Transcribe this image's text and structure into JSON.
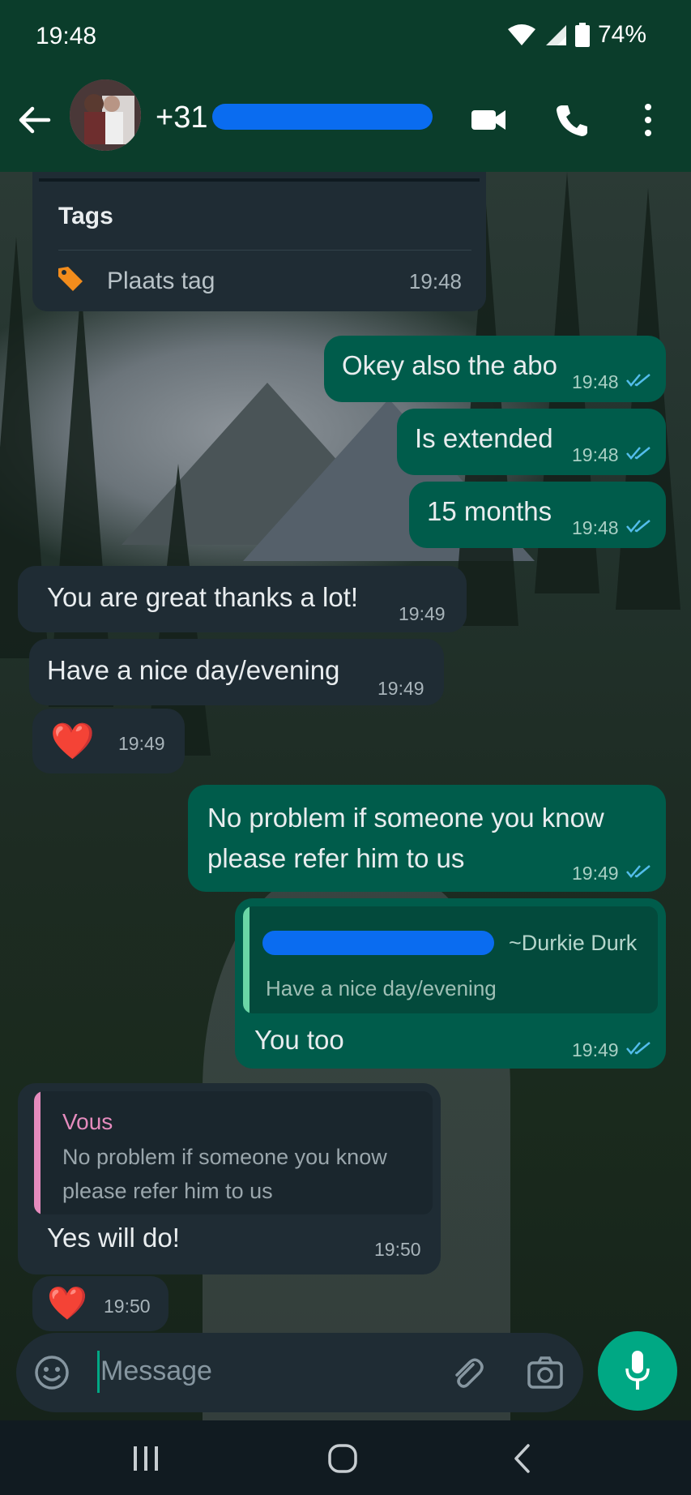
{
  "status_bar": {
    "time": "19:48",
    "battery": "74%"
  },
  "header": {
    "contact_prefix": "+31",
    "avatar_icon": "avatar"
  },
  "tags_card": {
    "title": "Tags",
    "placeholder": "Plaats tag",
    "time": "19:48"
  },
  "messages": [
    {
      "dir": "out",
      "text": "Okey also the abo",
      "time": "19:48",
      "status": "read"
    },
    {
      "dir": "out",
      "text": "Is extended",
      "time": "19:48",
      "status": "read"
    },
    {
      "dir": "out",
      "text": "15 months",
      "time": "19:48",
      "status": "read"
    },
    {
      "dir": "in",
      "text": "You are great thanks a lot!",
      "time": "19:49"
    },
    {
      "dir": "in",
      "text": "Have a nice day/evening",
      "time": "19:49"
    },
    {
      "dir": "in",
      "text": "❤️",
      "time": "19:49"
    },
    {
      "dir": "out",
      "line1": "No problem if someone you know",
      "line2": "please refer him to us",
      "time": "19:49",
      "status": "read"
    },
    {
      "dir": "out",
      "quote_author": "~Durkie Durk",
      "quote_text": "Have a nice day/evening",
      "text": "You too",
      "time": "19:49",
      "status": "read"
    },
    {
      "dir": "in",
      "quote_author": "Vous",
      "quote_line1": "No problem if someone you know",
      "quote_line2": "please refer him to us",
      "text": "Yes will do!",
      "time": "19:50"
    },
    {
      "dir": "in",
      "text": "❤️",
      "time": "19:50"
    }
  ],
  "input": {
    "placeholder": "Message"
  },
  "colors": {
    "header": "#0b3d2b",
    "incoming": "#1f2c34",
    "outgoing": "#005c4b",
    "accent": "#00a884",
    "read_ticks": "#53bdeb"
  }
}
